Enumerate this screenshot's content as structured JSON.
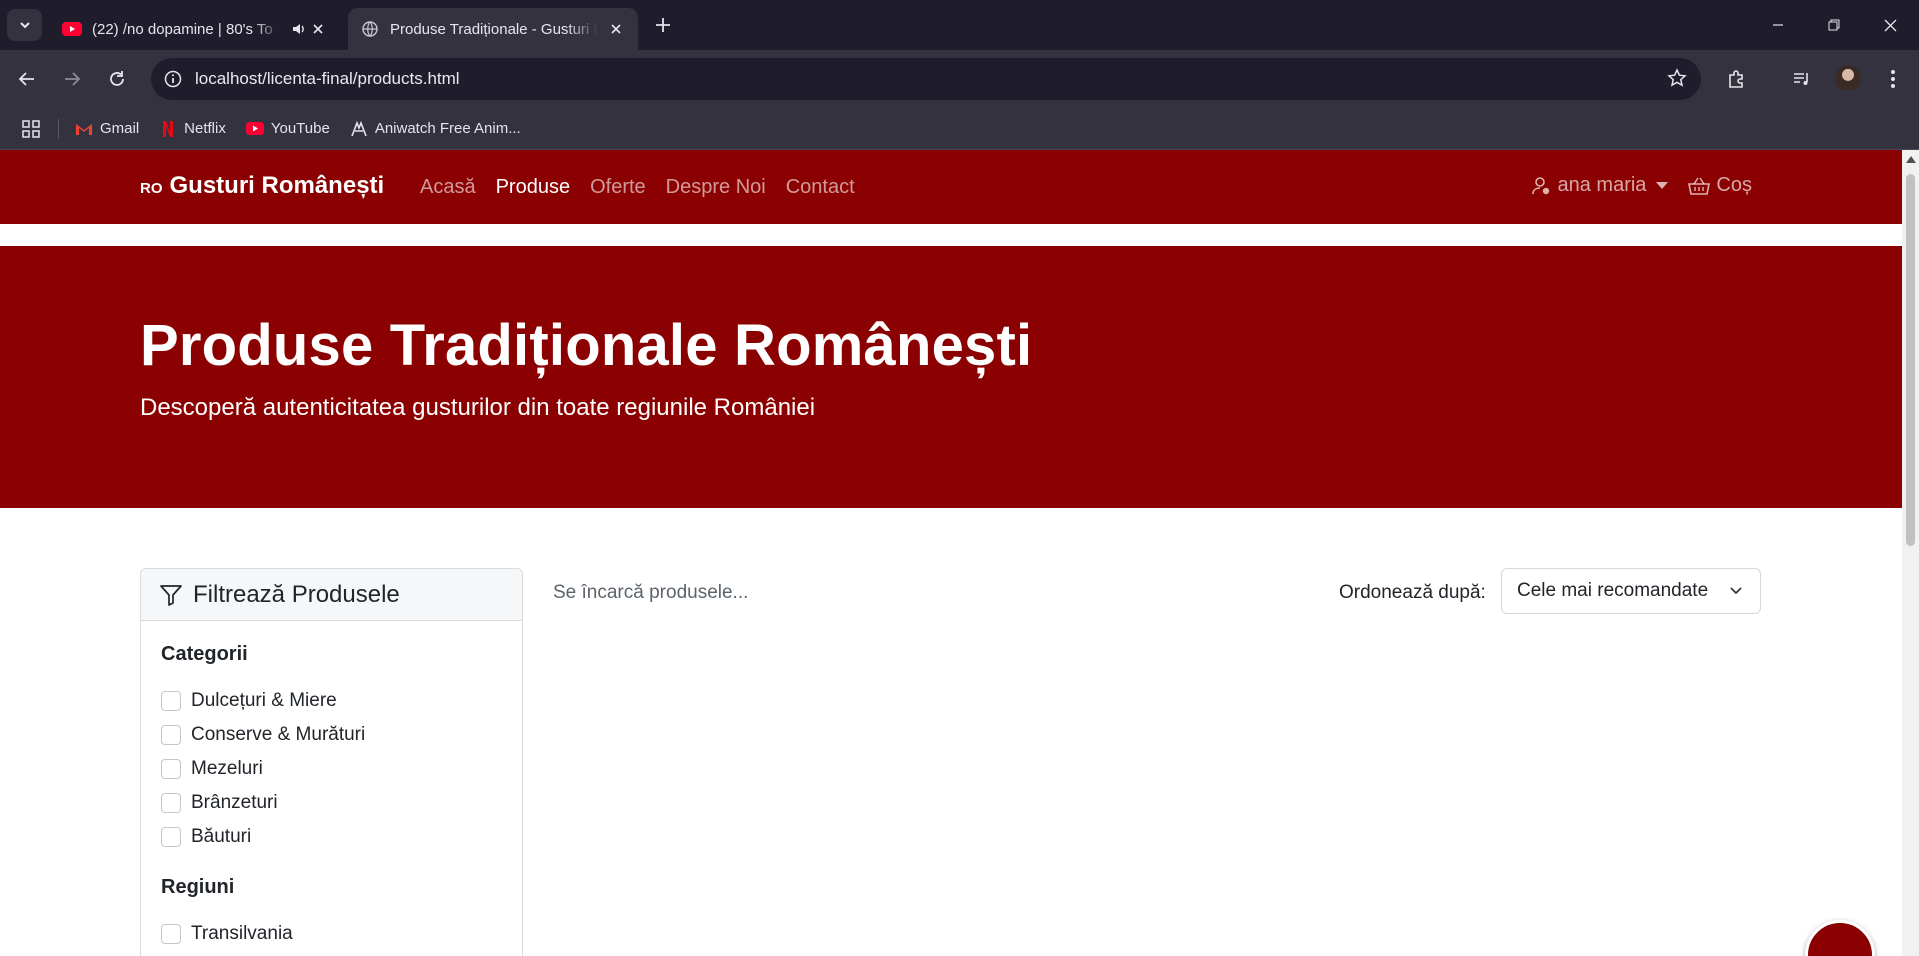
{
  "browser": {
    "tabs": [
      {
        "title": "(22) /no dopamine | 80's To",
        "icon": "youtube-icon",
        "audio": true,
        "active": false
      },
      {
        "title": "Produse Tradiționale - Gusturi R",
        "icon": "globe-icon",
        "active": true
      }
    ],
    "url": "localhost/licenta-final/products.html",
    "bookmarks": [
      {
        "label": "Gmail",
        "icon": "gmail-icon"
      },
      {
        "label": "Netflix",
        "icon": "netflix-icon"
      },
      {
        "label": "YouTube",
        "icon": "youtube-icon"
      },
      {
        "label": "Aniwatch Free Anim...",
        "icon": "aniwatch-icon"
      }
    ]
  },
  "site": {
    "brand_prefix": "RO",
    "brand": "Gusturi Românești",
    "nav": [
      "Acasă",
      "Produse",
      "Oferte",
      "Despre Noi",
      "Contact"
    ],
    "active_nav": "Produse",
    "user": "ana maria",
    "cart": "Coș",
    "accent": "#8b0000"
  },
  "hero": {
    "title": "Produse Tradiționale Românești",
    "subtitle": "Descoperă autenticitatea gusturilor din toate regiunile României"
  },
  "filters": {
    "title": "Filtrează Produsele",
    "categories_title": "Categorii",
    "categories": [
      "Dulcețuri & Miere",
      "Conserve & Murături",
      "Mezeluri",
      "Brânzeturi",
      "Băuturi"
    ],
    "regions_title": "Regiuni",
    "regions": [
      "Transilvania"
    ]
  },
  "products": {
    "loading_text": "Se încarcă produsele...",
    "sort_label": "Ordonează după:",
    "sort_value": "Cele mai recomandate"
  }
}
